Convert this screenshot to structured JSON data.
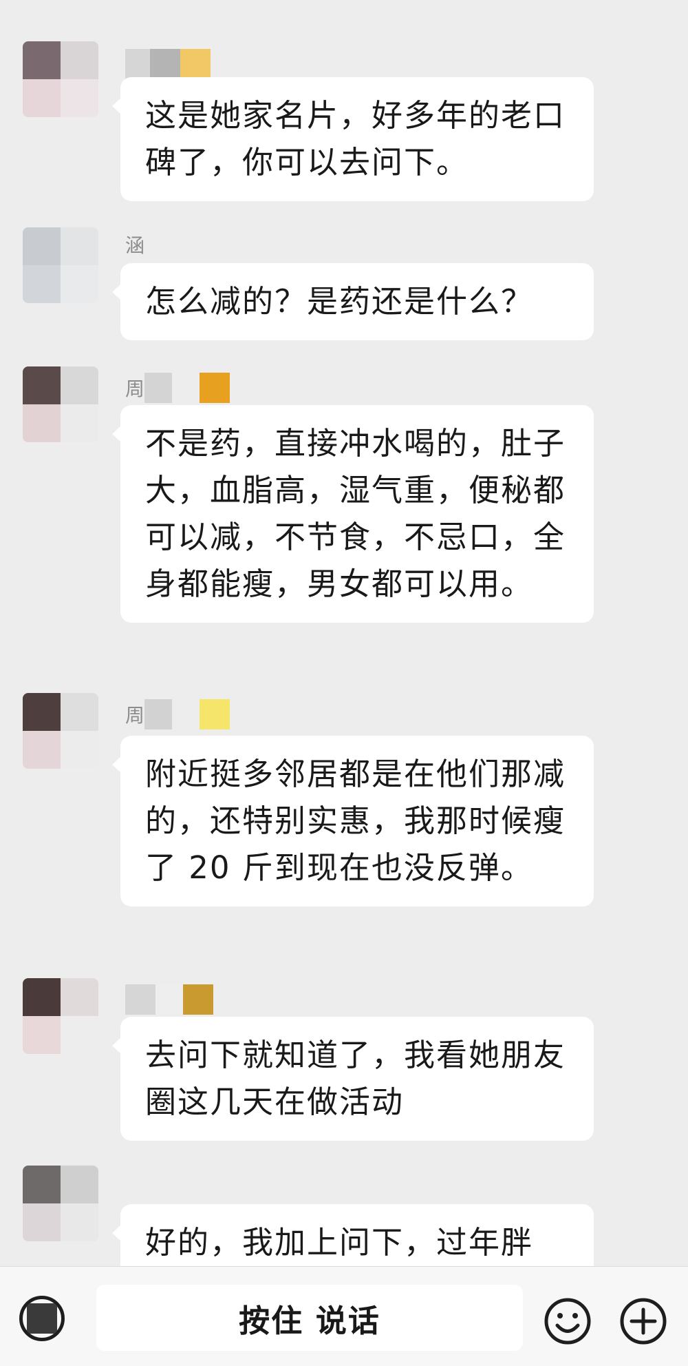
{
  "messages": [
    {
      "sender": "",
      "text": "这是她家名片，好多年的老口碑了，你可以去问下。",
      "avatar_colors": [
        "#7a6a70",
        "#d9d4d6",
        "#e6d6da",
        "#ece4e6"
      ],
      "name_colors": [
        "#d6d6d6",
        "#b4b4b4",
        "#f2c766"
      ]
    },
    {
      "sender": "涵",
      "text": "怎么减的？是药还是什么？",
      "avatar_colors": [
        "#c8ccd0",
        "#e2e4e6",
        "#d2d6da",
        "#e8eaec"
      ],
      "name_colors": []
    },
    {
      "sender": "周",
      "text": "不是药，直接冲水喝的，肚子大，血脂高，湿气重，便秘都可以减，不节食，不忌口，全身都能瘦，男女都可以用。",
      "avatar_colors": [
        "#5a4a4a",
        "#d8d8d8",
        "#e2d2d4",
        "#ebebeb"
      ],
      "name_colors": [
        "#d4d4d4",
        "#ededed",
        "#e8a020"
      ]
    },
    {
      "sender": "周",
      "text": "附近挺多邻居都是在他们那减的，还特别实惠，我那时候瘦了 20 斤到现在也没反弹。",
      "avatar_colors": [
        "#4e3e3e",
        "#dedede",
        "#e4d6d8",
        "#ececec"
      ],
      "name_colors": [
        "#d2d2d2",
        "#ededed",
        "#f5e56a"
      ]
    },
    {
      "sender": "",
      "text": "去问下就知道了，我看她朋友圈这几天在做活动",
      "avatar_colors": [
        "#4a3a3a",
        "#e0dada",
        "#e8d8da",
        "#ededed"
      ],
      "name_colors": [
        "#d6d6d6",
        "#eeeeee",
        "#c89a30"
      ]
    },
    {
      "sender": "",
      "text": "好的，我加上问下，过年胖",
      "avatar_colors": [
        "#6e6a6a",
        "#cfcfcf",
        "#dcd6d8",
        "#e8e8e8"
      ],
      "name_colors": []
    }
  ],
  "bottom_bar": {
    "hold_to_talk_label": "按住 说话"
  }
}
